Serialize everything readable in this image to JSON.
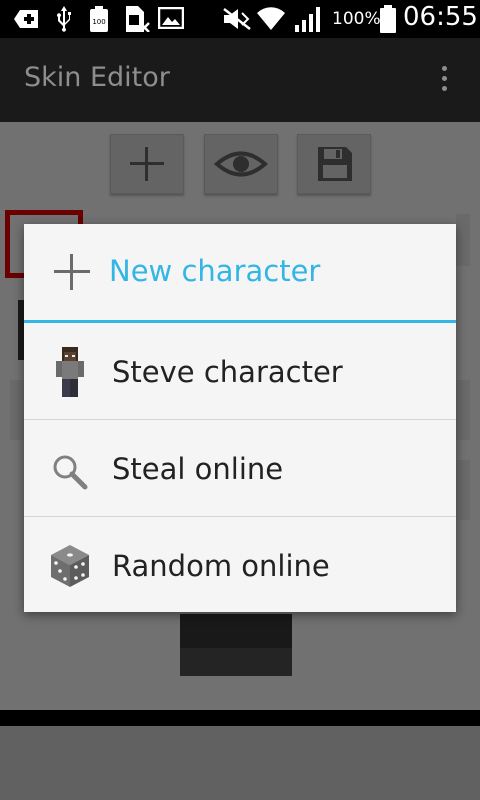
{
  "status_bar": {
    "battery_percent": "100%",
    "time": "06:55",
    "icons": [
      "add-icon",
      "usb-icon",
      "battery-100-icon",
      "sim-icon",
      "image-icon",
      "mute-icon",
      "wifi-icon",
      "signal-icon",
      "battery-icon"
    ]
  },
  "app_bar": {
    "title": "Skin Editor"
  },
  "toolbar": {
    "buttons": [
      "plus-icon",
      "eye-icon",
      "save-icon"
    ]
  },
  "dialog": {
    "title": "New character",
    "accent_color": "#33b5e5",
    "items": [
      {
        "label": "Steve character",
        "icon": "steve-character-icon"
      },
      {
        "label": "Steal online",
        "icon": "search-icon"
      },
      {
        "label": "Random online",
        "icon": "dice-icon"
      }
    ]
  }
}
